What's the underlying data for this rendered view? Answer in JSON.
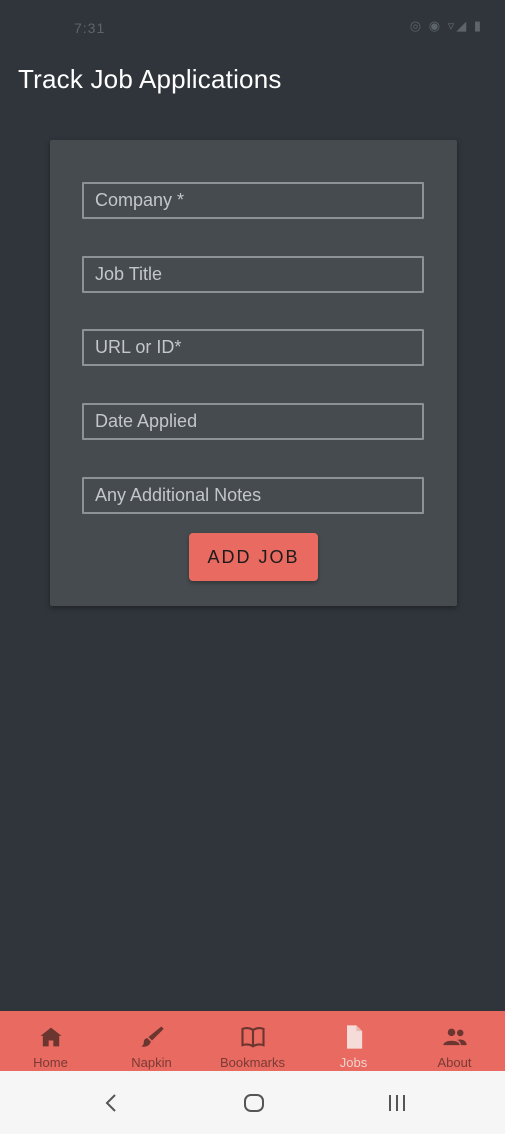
{
  "status_bar": {
    "time": "7:31",
    "icons": "◎ ◉ ▿◢ ▮"
  },
  "page": {
    "title": "Track Job Applications"
  },
  "form": {
    "company_placeholder": "Company *",
    "job_title_placeholder": "Job Title",
    "url_placeholder": "URL or ID*",
    "date_placeholder": "Date Applied",
    "notes_placeholder": "Any Additional Notes",
    "submit_label": "ADD JOB"
  },
  "bottom_nav": {
    "items": [
      {
        "label": "Home",
        "icon": "home-icon"
      },
      {
        "label": "Napkin",
        "icon": "brush-icon"
      },
      {
        "label": "Bookmarks",
        "icon": "book-icon"
      },
      {
        "label": "Jobs",
        "icon": "document-icon",
        "active": true
      },
      {
        "label": "About",
        "icon": "people-icon"
      }
    ]
  },
  "colors": {
    "background": "#2f353b",
    "card": "#454b4f",
    "accent": "#e86a60"
  }
}
